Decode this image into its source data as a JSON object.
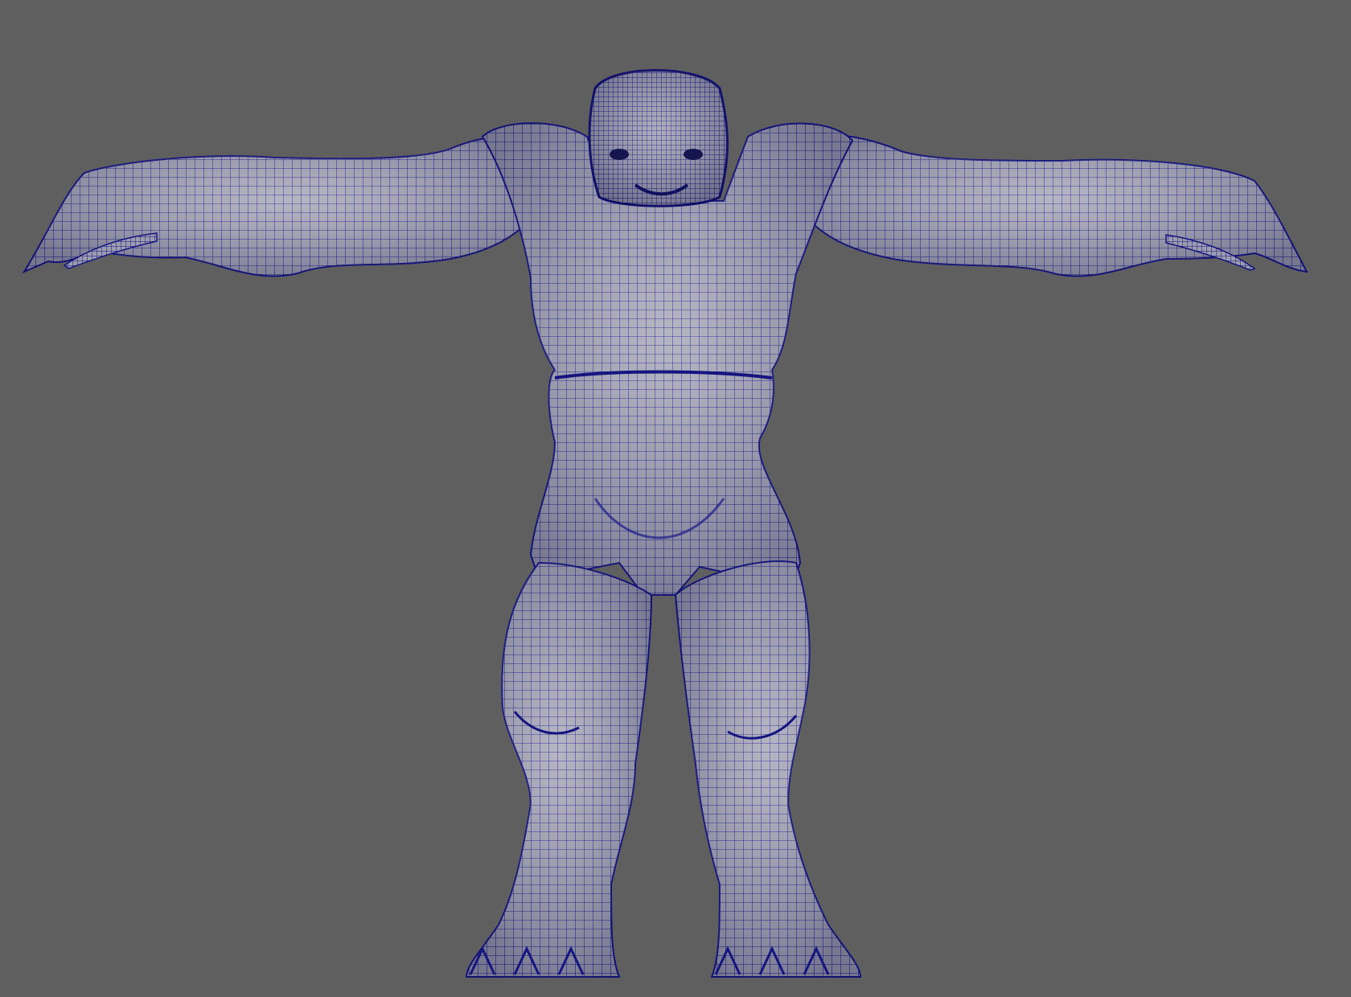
{
  "viewport": {
    "background": "#5f5f5f",
    "display_mode": "wireframe-on-shaded"
  },
  "model": {
    "description_icon": "creature-mesh-icon",
    "surface_color": "#a3a3b3",
    "wire_color": "#141487",
    "pose": "T-pose"
  }
}
